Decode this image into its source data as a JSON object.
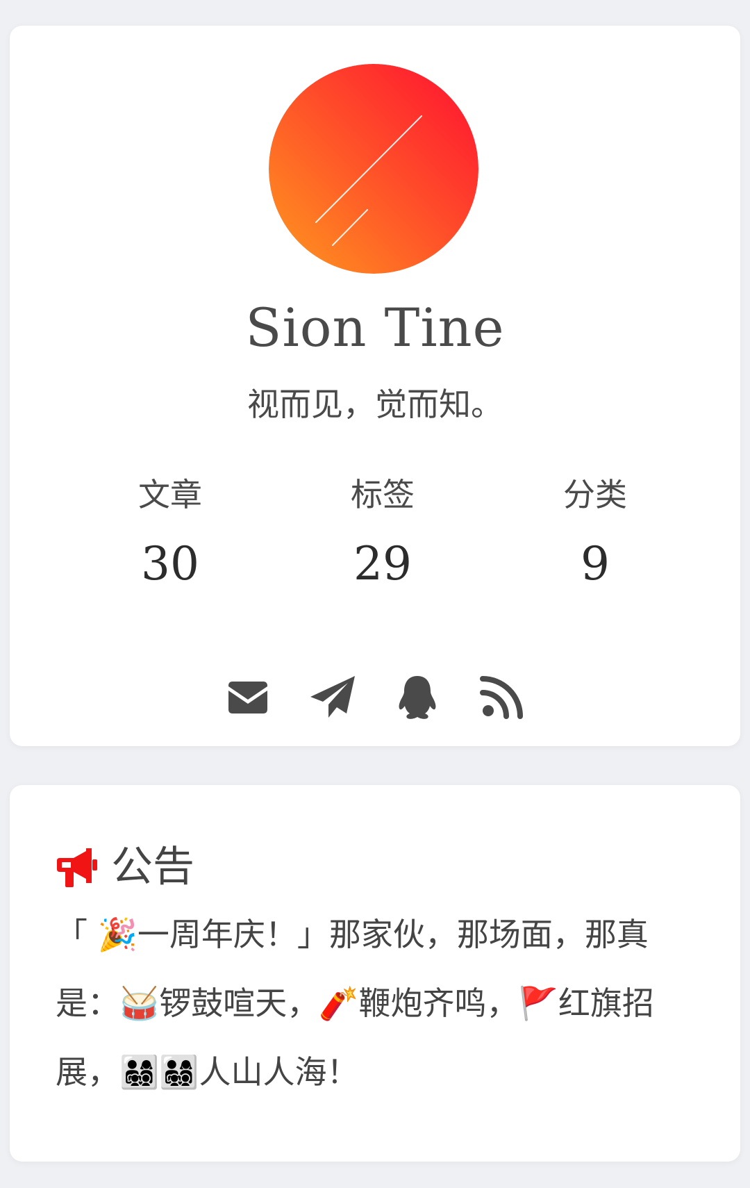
{
  "profile": {
    "name": "Sion Tine",
    "motto": "视而见，觉而知。",
    "avatar_colors": [
      "#ff9a1e",
      "#ff1a2e"
    ]
  },
  "stats": [
    {
      "label": "文章",
      "count": "30"
    },
    {
      "label": "标签",
      "count": "29"
    },
    {
      "label": "分类",
      "count": "9"
    }
  ],
  "social": [
    {
      "icon": "envelope-icon"
    },
    {
      "icon": "paper-plane-icon"
    },
    {
      "icon": "qq-icon"
    },
    {
      "icon": "rss-icon"
    }
  ],
  "notice": {
    "title": "公告",
    "icon": "bullhorn-icon",
    "icon_color": "#f01414",
    "body": "「 🎉一周年庆！」那家伙，那场面，那真是：🥁锣鼓喧天，🧨鞭炮齐鸣，🚩红旗招展，👨‍👩‍👧‍👦👨‍👩‍👧‍👦人山人海！"
  },
  "colors": {
    "background": "#eff0f4",
    "card": "#ffffff",
    "text": "#444444",
    "icon": "#4a4a4a"
  }
}
